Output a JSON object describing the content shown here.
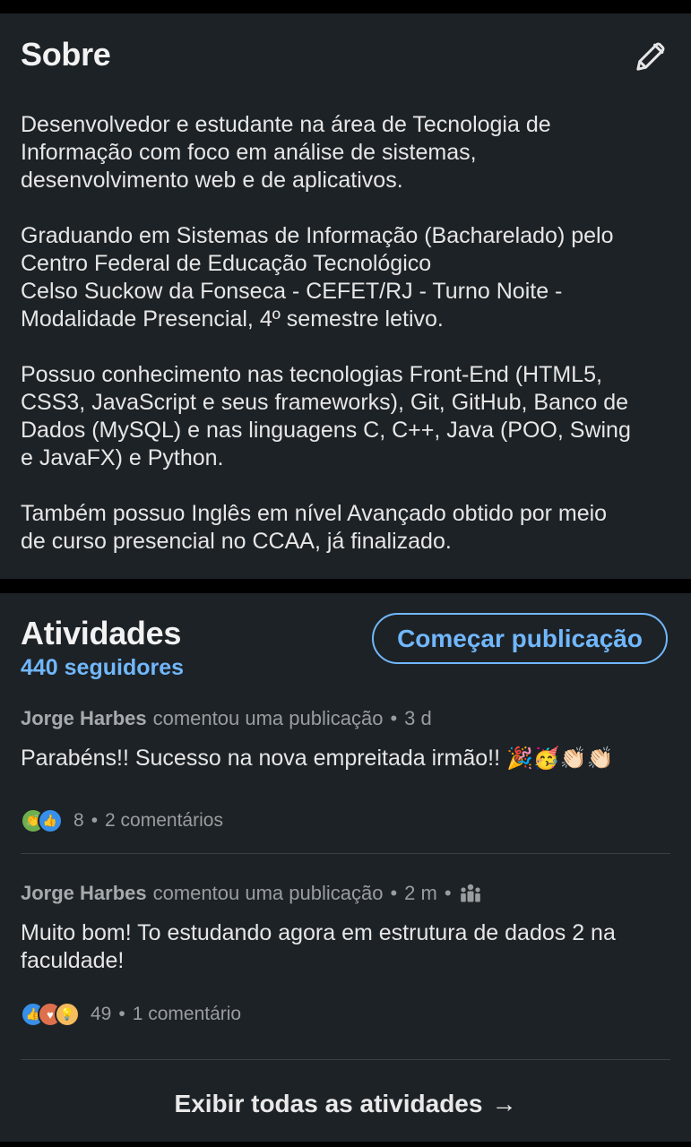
{
  "about": {
    "title": "Sobre",
    "edit_icon": "pencil-icon",
    "paragraphs": [
      "Desenvolvedor e estudante na área de Tecnologia de\nInformação com foco em análise de sistemas,\ndesenvolvimento web e de aplicativos.",
      "Graduando em Sistemas de Informação (Bacharelado) pelo\nCentro Federal de Educação Tecnológico\nCelso Suckow da Fonseca - CEFET/RJ - Turno Noite -\nModalidade Presencial, 4º semestre letivo.",
      "Possuo conhecimento nas tecnologias Front-End (HTML5,\nCSS3, JavaScript e seus frameworks), Git, GitHub, Banco de\nDados (MySQL) e nas linguagens C, C++, Java (POO, Swing\ne JavaFX) e Python.",
      "Também possuo Inglês em nível Avançado obtido por meio\nde curso presencial no CCAA, já finalizado."
    ]
  },
  "activity": {
    "title": "Atividades",
    "followers": "440 seguidores",
    "start_post_label": "Começar publicação",
    "items": [
      {
        "author": "Jorge Harbes",
        "action": "comentou uma publicação",
        "time": "3 d",
        "comment": "Parabéns!! Sucesso na nova empreitada irmão!!",
        "emojis": "🎉🥳👏🏻👏🏻",
        "reaction_count": "8",
        "comments": "2 comentários",
        "reaction_icons": [
          "clap-icon",
          "like-icon"
        ]
      },
      {
        "author": "Jorge Harbes",
        "action": "comentou uma publicação",
        "time": "2 m",
        "visibility_icon": "group-icon",
        "comment": "Muito bom! To estudando agora em estrutura de dados 2 na faculdade!",
        "reaction_count": "49",
        "comments": "1 comentário",
        "reaction_icons": [
          "like-icon",
          "love-icon",
          "idea-icon"
        ]
      }
    ],
    "show_all_label": "Exibir todas as atividades",
    "show_all_arrow": "→"
  },
  "colors": {
    "background": "#000000",
    "card": "#1d2226",
    "accent": "#71b7fb",
    "text": "#e9e9e9",
    "muted": "#9a9da0"
  }
}
